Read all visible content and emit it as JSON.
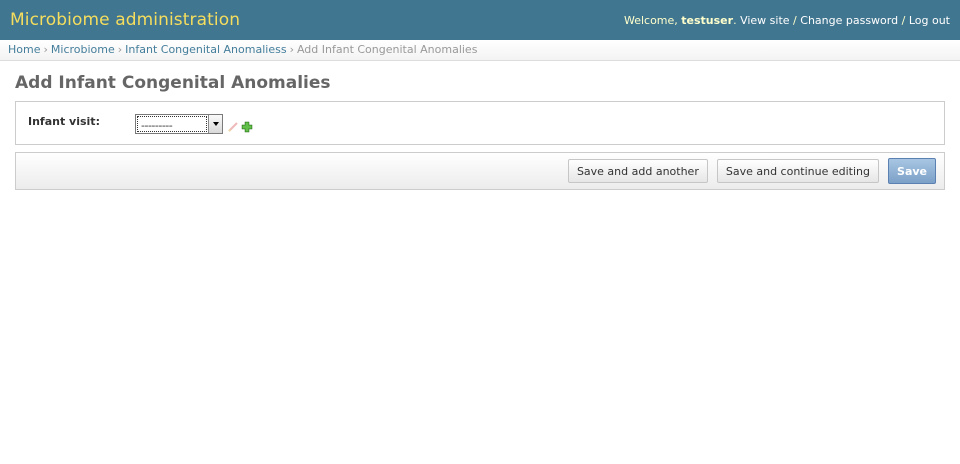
{
  "header": {
    "site_name": "Microbiome administration",
    "welcome_prefix": "Welcome, ",
    "username": "testuser",
    "welcome_suffix": ".",
    "view_site": "View site",
    "change_password": "Change password",
    "log_out": "Log out",
    "separator": "/"
  },
  "breadcrumbs": {
    "separator": "›",
    "items": [
      "Home",
      "Microbiome",
      "Infant Congenital Anomaliess"
    ],
    "current": "Add Infant Congenital Anomalies"
  },
  "page": {
    "title": "Add Infant Congenital Anomalies"
  },
  "form": {
    "fields": [
      {
        "label": "Infant visit:",
        "selected_value": "---------"
      }
    ]
  },
  "submit_row": {
    "save_add_another": "Save and add another",
    "save_continue": "Save and continue editing",
    "save": "Save"
  },
  "colors": {
    "header_bg": "#417690",
    "brand_text": "#f5dd5d",
    "link": "#447e9b",
    "save_button": "#7ca0c7"
  },
  "icons": {
    "change": "pencil-icon",
    "add": "plus-icon"
  }
}
